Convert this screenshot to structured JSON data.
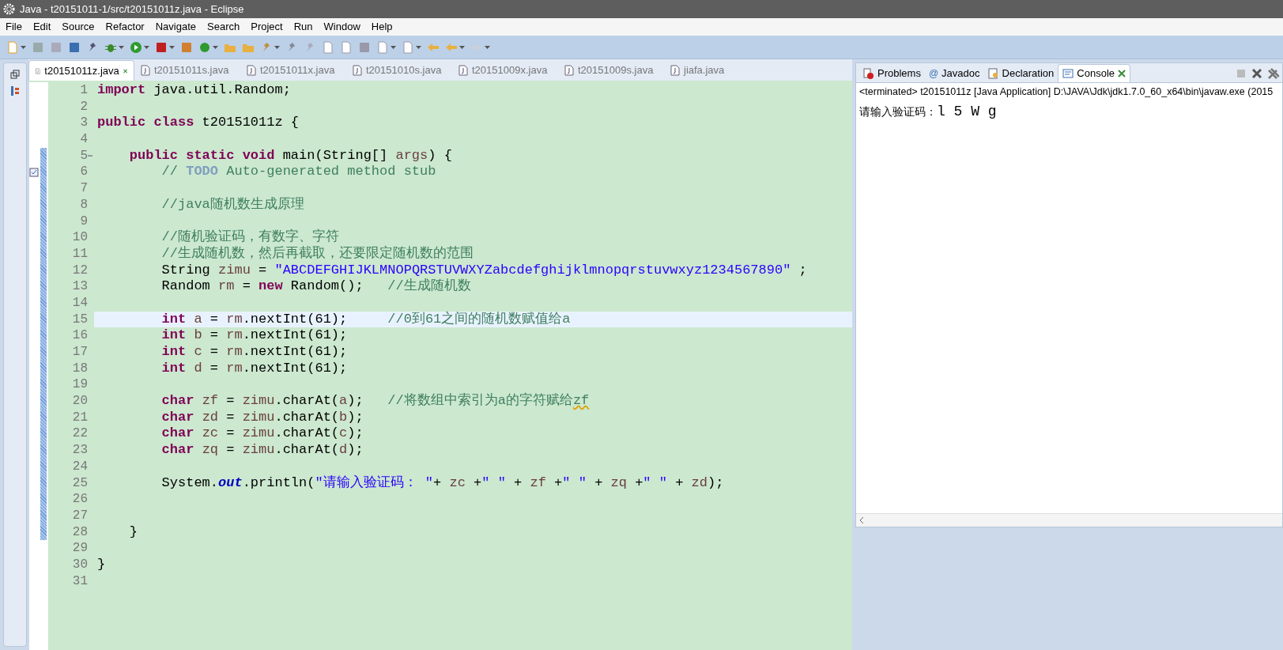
{
  "window": {
    "title": "Java - t20151011-1/src/t20151011z.java - Eclipse"
  },
  "menu": [
    "File",
    "Edit",
    "Source",
    "Refactor",
    "Navigate",
    "Search",
    "Project",
    "Run",
    "Window",
    "Help"
  ],
  "editor_tabs": [
    {
      "label": "t20151011z.java",
      "selected": true
    },
    {
      "label": "t20151011s.java",
      "selected": false
    },
    {
      "label": "t20151011x.java",
      "selected": false
    },
    {
      "label": "t20151010s.java",
      "selected": false
    },
    {
      "label": "t20151009x.java",
      "selected": false
    },
    {
      "label": "t20151009s.java",
      "selected": false
    },
    {
      "label": "jiafa.java",
      "selected": false
    }
  ],
  "code_lines": [
    {
      "number": "1",
      "current": false,
      "in_range": false,
      "tokens": [
        {
          "kind": "keyword",
          "text": "import"
        },
        {
          "kind": "plain",
          "text": " java.util.Random;"
        }
      ]
    },
    {
      "number": "2",
      "current": false,
      "in_range": false
    },
    {
      "number": "3",
      "current": false,
      "in_range": false,
      "tokens": [
        {
          "kind": "keyword",
          "text": "public class"
        },
        {
          "kind": "plain",
          "text": " t20151011z {"
        }
      ]
    },
    {
      "number": "4",
      "current": false,
      "in_range": false
    },
    {
      "number": "5",
      "current": false,
      "in_range": true,
      "fold": true,
      "tokens": [
        {
          "kind": "keyword",
          "text": "    public static void"
        },
        {
          "kind": "plain",
          "text": " main(String[] "
        },
        {
          "kind": "variable",
          "text": "args"
        },
        {
          "kind": "plain",
          "text": ") {"
        }
      ]
    },
    {
      "number": "6",
      "current": false,
      "in_range": true,
      "task": true,
      "tokens": [
        {
          "kind": "comment",
          "text": "        // "
        },
        {
          "kind": "todo",
          "text": "TODO"
        },
        {
          "kind": "comment",
          "text": " Auto-generated method stub"
        }
      ]
    },
    {
      "number": "7",
      "current": false,
      "in_range": true
    },
    {
      "number": "8",
      "current": false,
      "in_range": true,
      "tokens": [
        {
          "kind": "comment",
          "text": "        //java随机数生成原理"
        }
      ]
    },
    {
      "number": "9",
      "current": false,
      "in_range": true
    },
    {
      "number": "10",
      "current": false,
      "in_range": true,
      "tokens": [
        {
          "kind": "comment",
          "text": "        //随机验证码，有数字、字符"
        }
      ]
    },
    {
      "number": "11",
      "current": false,
      "in_range": true,
      "tokens": [
        {
          "kind": "comment",
          "text": "        //生成随机数，然后再截取，还要限定随机数的范围"
        }
      ]
    },
    {
      "number": "12",
      "current": false,
      "in_range": true,
      "tokens": [
        {
          "kind": "plain",
          "text": "        String "
        },
        {
          "kind": "variable",
          "text": "zimu"
        },
        {
          "kind": "plain",
          "text": " = "
        },
        {
          "kind": "string",
          "text": "\"ABCDEFGHIJKLMNOPQRSTUVWXYZabcdefghijklmnopqrstuvwxyz1234567890\""
        },
        {
          "kind": "plain",
          "text": " ;"
        }
      ]
    },
    {
      "number": "13",
      "current": false,
      "in_range": true,
      "tokens": [
        {
          "kind": "plain",
          "text": "        Random "
        },
        {
          "kind": "variable",
          "text": "rm"
        },
        {
          "kind": "plain",
          "text": " = "
        },
        {
          "kind": "keyword",
          "text": "new"
        },
        {
          "kind": "plain",
          "text": " Random();   "
        },
        {
          "kind": "comment",
          "text": "//生成随机数"
        }
      ]
    },
    {
      "number": "14",
      "current": false,
      "in_range": true
    },
    {
      "number": "15",
      "current": true,
      "in_range": true,
      "tokens": [
        {
          "kind": "keyword",
          "text": "        int "
        },
        {
          "kind": "variable",
          "text": "a"
        },
        {
          "kind": "plain",
          "text": " = "
        },
        {
          "kind": "variable",
          "text": "rm"
        },
        {
          "kind": "plain",
          "text": ".nextInt(61);     "
        },
        {
          "kind": "comment",
          "text": "//0到61之间的随机数赋值给a"
        }
      ]
    },
    {
      "number": "16",
      "current": false,
      "in_range": true,
      "tokens": [
        {
          "kind": "keyword",
          "text": "        int "
        },
        {
          "kind": "variable",
          "text": "b"
        },
        {
          "kind": "plain",
          "text": " = "
        },
        {
          "kind": "variable",
          "text": "rm"
        },
        {
          "kind": "plain",
          "text": ".nextInt(61);"
        }
      ]
    },
    {
      "number": "17",
      "current": false,
      "in_range": true,
      "tokens": [
        {
          "kind": "keyword",
          "text": "        int "
        },
        {
          "kind": "variable",
          "text": "c"
        },
        {
          "kind": "plain",
          "text": " = "
        },
        {
          "kind": "variable",
          "text": "rm"
        },
        {
          "kind": "plain",
          "text": ".nextInt(61);"
        }
      ]
    },
    {
      "number": "18",
      "current": false,
      "in_range": true,
      "tokens": [
        {
          "kind": "keyword",
          "text": "        int "
        },
        {
          "kind": "variable",
          "text": "d"
        },
        {
          "kind": "plain",
          "text": " = "
        },
        {
          "kind": "variable",
          "text": "rm"
        },
        {
          "kind": "plain",
          "text": ".nextInt(61);"
        }
      ]
    },
    {
      "number": "19",
      "current": false,
      "in_range": true
    },
    {
      "number": "20",
      "current": false,
      "in_range": true,
      "tokens": [
        {
          "kind": "keyword",
          "text": "        char "
        },
        {
          "kind": "variable",
          "text": "zf"
        },
        {
          "kind": "plain",
          "text": " = "
        },
        {
          "kind": "variable",
          "text": "zimu"
        },
        {
          "kind": "plain",
          "text": ".charAt("
        },
        {
          "kind": "variable",
          "text": "a"
        },
        {
          "kind": "plain",
          "text": ");   "
        },
        {
          "kind": "comment",
          "text": "//将数组中索引为a的字符赋给"
        },
        {
          "kind": "misspelled",
          "text": "zf"
        }
      ]
    },
    {
      "number": "21",
      "current": false,
      "in_range": true,
      "tokens": [
        {
          "kind": "keyword",
          "text": "        char "
        },
        {
          "kind": "variable",
          "text": "zd"
        },
        {
          "kind": "plain",
          "text": " = "
        },
        {
          "kind": "variable",
          "text": "zimu"
        },
        {
          "kind": "plain",
          "text": ".charAt("
        },
        {
          "kind": "variable",
          "text": "b"
        },
        {
          "kind": "plain",
          "text": ");"
        }
      ]
    },
    {
      "number": "22",
      "current": false,
      "in_range": true,
      "tokens": [
        {
          "kind": "keyword",
          "text": "        char "
        },
        {
          "kind": "variable",
          "text": "zc"
        },
        {
          "kind": "plain",
          "text": " = "
        },
        {
          "kind": "variable",
          "text": "zimu"
        },
        {
          "kind": "plain",
          "text": ".charAt("
        },
        {
          "kind": "variable",
          "text": "c"
        },
        {
          "kind": "plain",
          "text": ");"
        }
      ]
    },
    {
      "number": "23",
      "current": false,
      "in_range": true,
      "tokens": [
        {
          "kind": "keyword",
          "text": "        char "
        },
        {
          "kind": "variable",
          "text": "zq"
        },
        {
          "kind": "plain",
          "text": " = "
        },
        {
          "kind": "variable",
          "text": "zimu"
        },
        {
          "kind": "plain",
          "text": ".charAt("
        },
        {
          "kind": "variable",
          "text": "d"
        },
        {
          "kind": "plain",
          "text": ");"
        }
      ]
    },
    {
      "number": "24",
      "current": false,
      "in_range": true
    },
    {
      "number": "25",
      "current": false,
      "in_range": true,
      "tokens": [
        {
          "kind": "plain",
          "text": "        System."
        },
        {
          "kind": "field",
          "text": "out"
        },
        {
          "kind": "plain",
          "text": ".println("
        },
        {
          "kind": "string",
          "text": "\"请输入验证码： \""
        },
        {
          "kind": "plain",
          "text": "+ "
        },
        {
          "kind": "variable",
          "text": "zc"
        },
        {
          "kind": "plain",
          "text": " +"
        },
        {
          "kind": "string",
          "text": "\" \""
        },
        {
          "kind": "plain",
          "text": " + "
        },
        {
          "kind": "variable",
          "text": "zf"
        },
        {
          "kind": "plain",
          "text": " +"
        },
        {
          "kind": "string",
          "text": "\" \""
        },
        {
          "kind": "plain",
          "text": " + "
        },
        {
          "kind": "variable",
          "text": "zq"
        },
        {
          "kind": "plain",
          "text": " +"
        },
        {
          "kind": "string",
          "text": "\" \""
        },
        {
          "kind": "plain",
          "text": " + "
        },
        {
          "kind": "variable",
          "text": "zd"
        },
        {
          "kind": "plain",
          "text": ");"
        }
      ]
    },
    {
      "number": "26",
      "current": false,
      "in_range": true
    },
    {
      "number": "27",
      "current": false,
      "in_range": true
    },
    {
      "number": "28",
      "current": false,
      "in_range": true,
      "tokens": [
        {
          "kind": "plain",
          "text": "    }"
        }
      ]
    },
    {
      "number": "29",
      "current": false,
      "in_range": false
    },
    {
      "number": "30",
      "current": false,
      "in_range": false,
      "tokens": [
        {
          "kind": "plain",
          "text": "}"
        }
      ]
    },
    {
      "number": "31",
      "current": false,
      "in_range": false
    }
  ],
  "console_tabs": [
    {
      "label": "Problems",
      "selected": false
    },
    {
      "label": "Javadoc",
      "icon_text": "@",
      "selected": false
    },
    {
      "label": "Declaration",
      "selected": false
    },
    {
      "label": "Console",
      "selected": true
    }
  ],
  "console": {
    "header": "<terminated> t20151011z [Java Application] D:\\JAVA\\Jdk\\jdk1.7.0_60_x64\\bin\\javaw.exe (2015",
    "prompt": "请输入验证码：",
    "output": "l 5 W g"
  }
}
